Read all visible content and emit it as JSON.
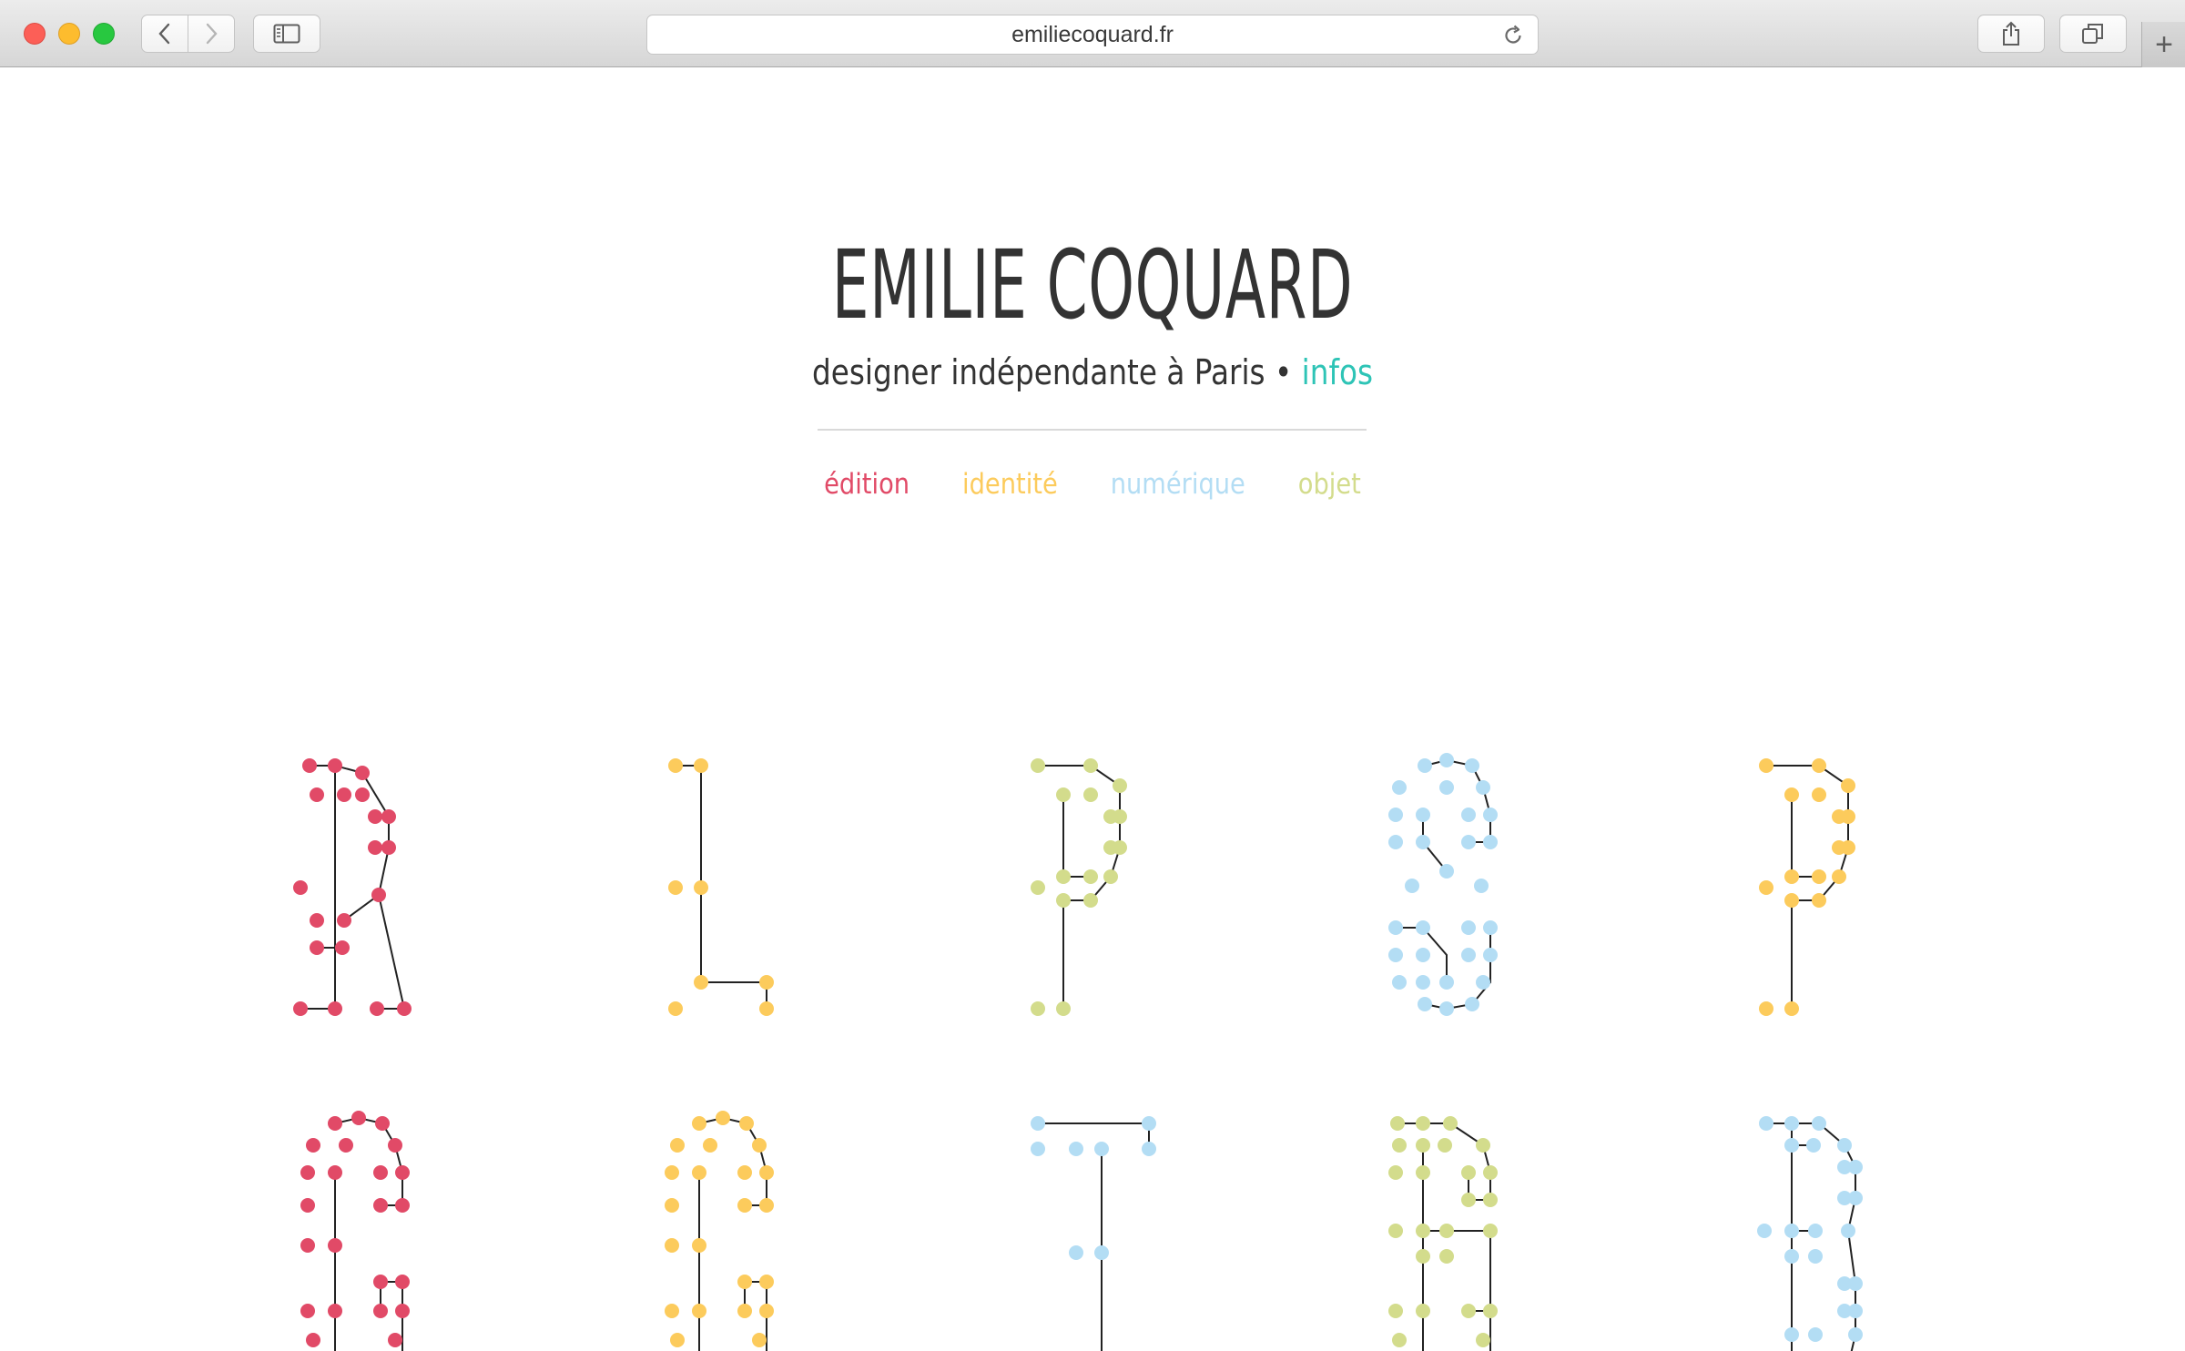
{
  "browser": {
    "url": "emiliecoquard.fr",
    "icons": {
      "back": "chevron-left-icon",
      "forward": "chevron-right-icon",
      "sidebar": "sidebar-icon",
      "reload": "reload-icon",
      "share": "share-icon",
      "tabs": "tabs-overview-icon",
      "new_tab": "plus-icon"
    }
  },
  "header": {
    "title": "EMILIE COQUARD",
    "tagline": "designer indépendante à Paris",
    "separator": "•",
    "infos_link": "infos"
  },
  "categories": [
    {
      "label": "édition",
      "color": "#e14a67"
    },
    {
      "label": "identité",
      "color": "#fccb5c"
    },
    {
      "label": "numérique",
      "color": "#b3ddf4"
    },
    {
      "label": "objet",
      "color": "#d3dc8c"
    }
  ],
  "colors": {
    "title": "#333333",
    "infos": "#2ec4b6",
    "edition": "#e14a67",
    "identite": "#fccb5c",
    "numerique": "#b3ddf4",
    "objet": "#d3dc8c",
    "stroke": "#222222"
  },
  "letter_grid": [
    {
      "letter": "R",
      "category": "edition"
    },
    {
      "letter": "L",
      "category": "identite"
    },
    {
      "letter": "P",
      "category": "objet"
    },
    {
      "letter": "8",
      "category": "numerique"
    },
    {
      "letter": "P",
      "category": "identite"
    },
    {
      "letter": "G",
      "category": "edition"
    },
    {
      "letter": "G",
      "category": "identite"
    },
    {
      "letter": "T",
      "category": "numerique"
    },
    {
      "letter": "B",
      "category": "objet"
    },
    {
      "letter": "B",
      "category": "numerique"
    }
  ]
}
